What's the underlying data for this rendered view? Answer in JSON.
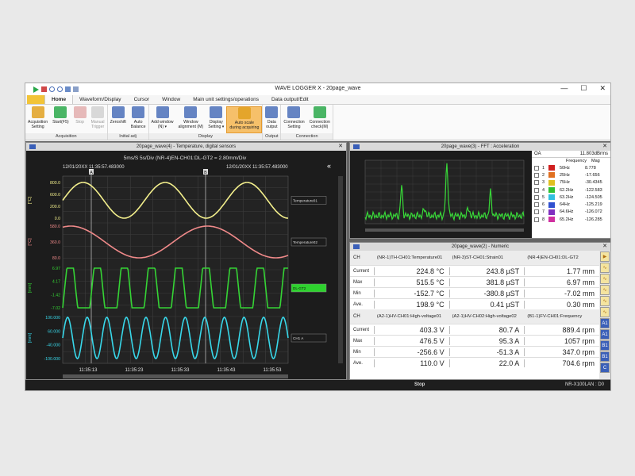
{
  "window": {
    "title": "WAVE LOGGER X - 20page_wave",
    "minimize": "—",
    "maximize": "☐",
    "close": "✕"
  },
  "tabs": [
    "Home",
    "Waveform/Display",
    "Cursor",
    "Window",
    "Main unit settings/operations",
    "Data output/Edit"
  ],
  "ribbon": {
    "groups": [
      {
        "label": "Acquisition",
        "buttons": [
          {
            "label": "Acquisition\nSetting",
            "color": "#e0a020",
            "dim": false
          },
          {
            "label": "Start(F5)",
            "color": "#2aa84a",
            "dim": false
          },
          {
            "label": "Stop",
            "color": "#c04040",
            "dim": true
          },
          {
            "label": "Manual\nTrigger",
            "color": "#999999",
            "dim": true
          }
        ]
      },
      {
        "label": "Initial adj",
        "buttons": [
          {
            "label": "Zeroshift",
            "color": "#4a6fb8",
            "dim": false
          },
          {
            "label": "Auto\nBalance",
            "color": "#4a6fb8",
            "dim": false
          }
        ]
      },
      {
        "label": "Display",
        "buttons": [
          {
            "label": "Add window\n(N) ▾",
            "color": "#4a6fb8",
            "dim": false
          },
          {
            "label": "Window\nalignment (M)",
            "color": "#4a6fb8",
            "dim": false
          },
          {
            "label": "Display\nSetting ▾",
            "color": "#4a6fb8",
            "dim": false
          },
          {
            "label": "Auto scale\nduring acquiring",
            "color": "#e0a020",
            "dim": false,
            "highlight": true
          }
        ]
      },
      {
        "label": "Output",
        "buttons": [
          {
            "label": "Data\noutput",
            "color": "#4a6fb8",
            "dim": false
          }
        ]
      },
      {
        "label": "Connection",
        "buttons": [
          {
            "label": "Connection\nSetting",
            "color": "#4a6fb8",
            "dim": false
          },
          {
            "label": "Connection\ncheck(M)",
            "color": "#2aa84a",
            "dim": false
          }
        ]
      }
    ]
  },
  "wave": {
    "title": "20page_wave(4) - Temperature, digital sensors",
    "header_line": "5ms/S   5s/Div      (NR-4)EN-CH01:DL-GT2 = 2.80mm/Div",
    "time_left": "12/01/20XX 11:35:57.483000",
    "time_right": "12/01/20XX 11:35:57.483000",
    "cursor_a": "A",
    "cursor_b": "B",
    "collapse": "«",
    "channels": [
      {
        "unit": "[°C]",
        "color": "#f3ef8c",
        "ticks": [
          "800.0",
          "600.0",
          "200.0",
          "0.0"
        ],
        "tag": "Temperature01",
        "tag_bg": "#1c1c1c",
        "tag_fg": "#ddd"
      },
      {
        "unit": "[°C]",
        "color": "#f08a8a",
        "ticks": [
          "580.0",
          "360.0",
          "80.0"
        ],
        "tag": "Temperature02",
        "tag_bg": "#1c1c1c",
        "tag_fg": "#ddd"
      },
      {
        "unit": "[mm]",
        "color": "#35d435",
        "ticks": [
          "6.97",
          "4.17",
          "-1.42",
          "-7.02"
        ],
        "tag": "DL-GT2",
        "tag_bg": "#2ed22e",
        "tag_fg": "#111"
      },
      {
        "unit": "[mm]",
        "color": "#38d8ea",
        "ticks": [
          "100.000",
          "60.000",
          "-40.000",
          "-100.000"
        ],
        "tag": "CH1 A",
        "tag_bg": "#1c1c1c",
        "tag_fg": "#ddd"
      }
    ],
    "x_ticks": [
      "11:35:13",
      "11:35:23",
      "11:35:33",
      "11:35:43",
      "11:35:53"
    ]
  },
  "fft": {
    "title": "20page_wave(3) - FFT : Acceleration",
    "oa_label": "OA",
    "oa_value": "11.803dBrms",
    "col_freq": "Frequency",
    "col_mag": "Mag",
    "rows": [
      {
        "idx": "1",
        "color": "#d02020",
        "freq": "50Hz",
        "mag": "8.778"
      },
      {
        "idx": "2",
        "color": "#e07020",
        "freq": "25Hz",
        "mag": "-17.656"
      },
      {
        "idx": "3",
        "color": "#e0c020",
        "freq": "75Hz",
        "mag": "-30.4345"
      },
      {
        "idx": "4",
        "color": "#30c030",
        "freq": "62.2Hz",
        "mag": "-122.583"
      },
      {
        "idx": "5",
        "color": "#30c0e0",
        "freq": "63.2Hz",
        "mag": "-124.505"
      },
      {
        "idx": "6",
        "color": "#3050d0",
        "freq": "64Hz",
        "mag": "-125.219"
      },
      {
        "idx": "7",
        "color": "#8030c0",
        "freq": "64.6Hz",
        "mag": "-126.072"
      },
      {
        "idx": "8",
        "color": "#d030a0",
        "freq": "65.2Hz",
        "mag": "-126.285"
      }
    ]
  },
  "numeric": {
    "title": "20page_wave(2) - Numeric",
    "blocks": [
      {
        "label": "CH",
        "headers": [
          "(NR-1)TH-CH01:Temperature01",
          "(NR-3)ST-CH01:Strain01",
          "(NR-4)EN-CH01:DL-GT2"
        ],
        "rows": [
          {
            "label": "Current",
            "values": [
              "224.8 °C",
              "243.8 µST",
              "1.77 mm"
            ]
          },
          {
            "label": "Max",
            "values": [
              "515.5 °C",
              "381.8 µST",
              "6.97 mm"
            ]
          },
          {
            "label": "Min",
            "values": [
              "-152.7 °C",
              "-380.8 µST",
              "-7.02 mm"
            ]
          },
          {
            "label": "Ave.",
            "values": [
              "198.9 °C",
              "0.41 µST",
              "0.30 mm"
            ]
          }
        ]
      },
      {
        "label": "CH",
        "headers": [
          "(A2-1)HV-CH01:High-voltage01",
          "(A2-1)HV-CH02:High-voltage02",
          "(B1-1)FV-CH01:Frequency"
        ],
        "rows": [
          {
            "label": "Current",
            "values": [
              "403.3 V",
              "80.7 A",
              "889.4 rpm"
            ]
          },
          {
            "label": "Max",
            "values": [
              "476.5 V",
              "95.3 A",
              "1057 rpm"
            ]
          },
          {
            "label": "Min",
            "values": [
              "-256.6 V",
              "-51.3 A",
              "347.0 rpm"
            ]
          },
          {
            "label": "Ave.",
            "values": [
              "110.0 V",
              "22.0 A",
              "704.6 rpm"
            ]
          }
        ]
      }
    ],
    "side_icons": [
      "▶",
      "∿",
      "∿",
      "∿",
      "∿",
      "∿",
      "A1",
      "A1",
      "B1",
      "B1",
      "C"
    ]
  },
  "status": {
    "state": "Stop",
    "port": "NR-X100LAN : D0"
  }
}
